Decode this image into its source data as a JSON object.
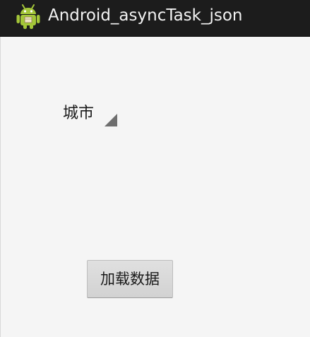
{
  "action_bar": {
    "title": "Android_asyncTask_json",
    "icon": "android-robot-icon",
    "background": "#1c1c1c"
  },
  "spinner": {
    "label": "城市",
    "icon": "spinner-dropdown-arrow-icon"
  },
  "load_button": {
    "label": "加载数据"
  },
  "colors": {
    "android_green": "#a4c639",
    "content_background": "#f5f5f5"
  }
}
